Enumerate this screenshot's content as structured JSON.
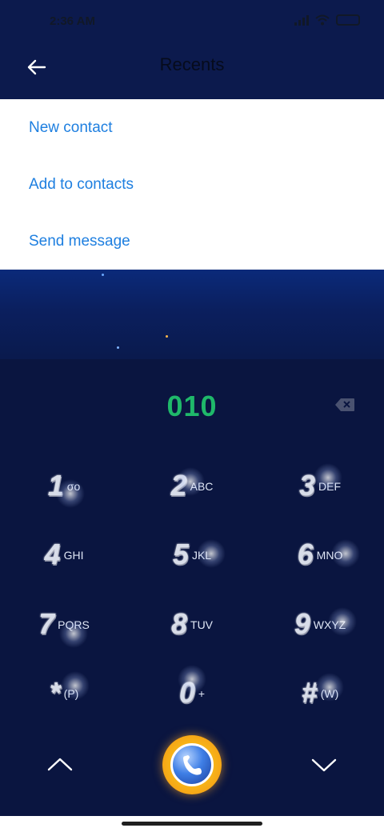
{
  "status_bar": {
    "time": "2:36 AM"
  },
  "header": {
    "title": "Recents"
  },
  "menu": {
    "items": [
      {
        "label": "New contact"
      },
      {
        "label": "Add to contacts"
      },
      {
        "label": "Send message"
      }
    ]
  },
  "dialer": {
    "number": "010",
    "keys": [
      {
        "digit": "1",
        "letters": "σο"
      },
      {
        "digit": "2",
        "letters": "ABC"
      },
      {
        "digit": "3",
        "letters": "DEF"
      },
      {
        "digit": "4",
        "letters": "GHI"
      },
      {
        "digit": "5",
        "letters": "JKL"
      },
      {
        "digit": "6",
        "letters": "MNO"
      },
      {
        "digit": "7",
        "letters": "PQRS"
      },
      {
        "digit": "8",
        "letters": "TUV"
      },
      {
        "digit": "9",
        "letters": "WXYZ"
      },
      {
        "digit": "*",
        "letters": "(P)"
      },
      {
        "digit": "0",
        "letters": "+"
      },
      {
        "digit": "#",
        "letters": "(W)"
      }
    ]
  },
  "colors": {
    "accent": "#1e7fe0",
    "number": "#1fb86a",
    "background": "#0a1540"
  }
}
